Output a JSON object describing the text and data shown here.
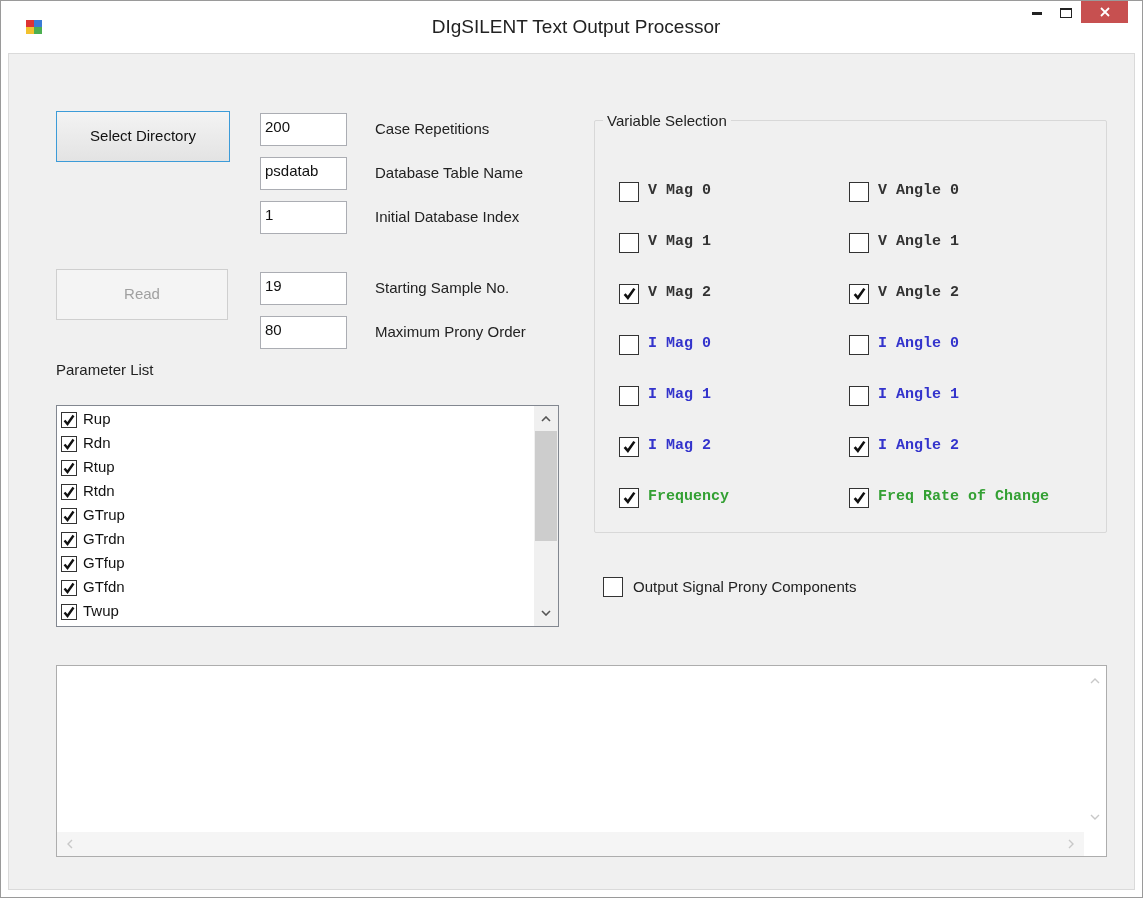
{
  "window": {
    "title": "DIgSILENT Text Output Processor"
  },
  "buttons": [
    {
      "label": "Select Directory",
      "disabled": false
    },
    {
      "label": "Read",
      "disabled": true
    }
  ],
  "field_groups": [
    [
      {
        "value": "200",
        "label": "Case Repetitions"
      },
      {
        "value": "psdatab",
        "label": "Database Table Name"
      },
      {
        "value": "1",
        "label": "Initial Database Index"
      }
    ],
    [
      {
        "value": "19",
        "label": "Starting Sample No."
      },
      {
        "value": "80",
        "label": "Maximum Prony Order"
      }
    ]
  ],
  "parameter_list": {
    "label": "Parameter List",
    "items": [
      {
        "label": "Rup",
        "checked": true
      },
      {
        "label": "Rdn",
        "checked": true
      },
      {
        "label": "Rtup",
        "checked": true
      },
      {
        "label": "Rtdn",
        "checked": true
      },
      {
        "label": "GTrup",
        "checked": true
      },
      {
        "label": "GTrdn",
        "checked": true
      },
      {
        "label": "GTfup",
        "checked": true
      },
      {
        "label": "GTfdn",
        "checked": true
      },
      {
        "label": "Twup",
        "checked": true
      }
    ]
  },
  "variable_selection": {
    "title": "Variable Selection",
    "items": [
      {
        "label": "V Mag 0",
        "checked": false,
        "color": "#333333"
      },
      {
        "label": "V Angle 0",
        "checked": false,
        "color": "#333333"
      },
      {
        "label": "V Mag 1",
        "checked": false,
        "color": "#333333"
      },
      {
        "label": "V Angle 1",
        "checked": false,
        "color": "#333333"
      },
      {
        "label": "V Mag 2",
        "checked": true,
        "color": "#333333"
      },
      {
        "label": "V Angle 2",
        "checked": true,
        "color": "#333333"
      },
      {
        "label": "I Mag 0",
        "checked": false,
        "color": "#3333cc"
      },
      {
        "label": "I Angle 0",
        "checked": false,
        "color": "#3333cc"
      },
      {
        "label": "I Mag 1",
        "checked": false,
        "color": "#3333cc"
      },
      {
        "label": "I Angle 1",
        "checked": false,
        "color": "#3333cc"
      },
      {
        "label": "I Mag 2",
        "checked": true,
        "color": "#3333cc"
      },
      {
        "label": "I Angle 2",
        "checked": true,
        "color": "#3333cc"
      },
      {
        "label": "Frequency",
        "checked": true,
        "color": "#33a033"
      },
      {
        "label": "Freq Rate of Change",
        "checked": true,
        "color": "#33a033"
      }
    ]
  },
  "output_prony": {
    "label": "Output Signal Prony Components",
    "checked": false
  }
}
